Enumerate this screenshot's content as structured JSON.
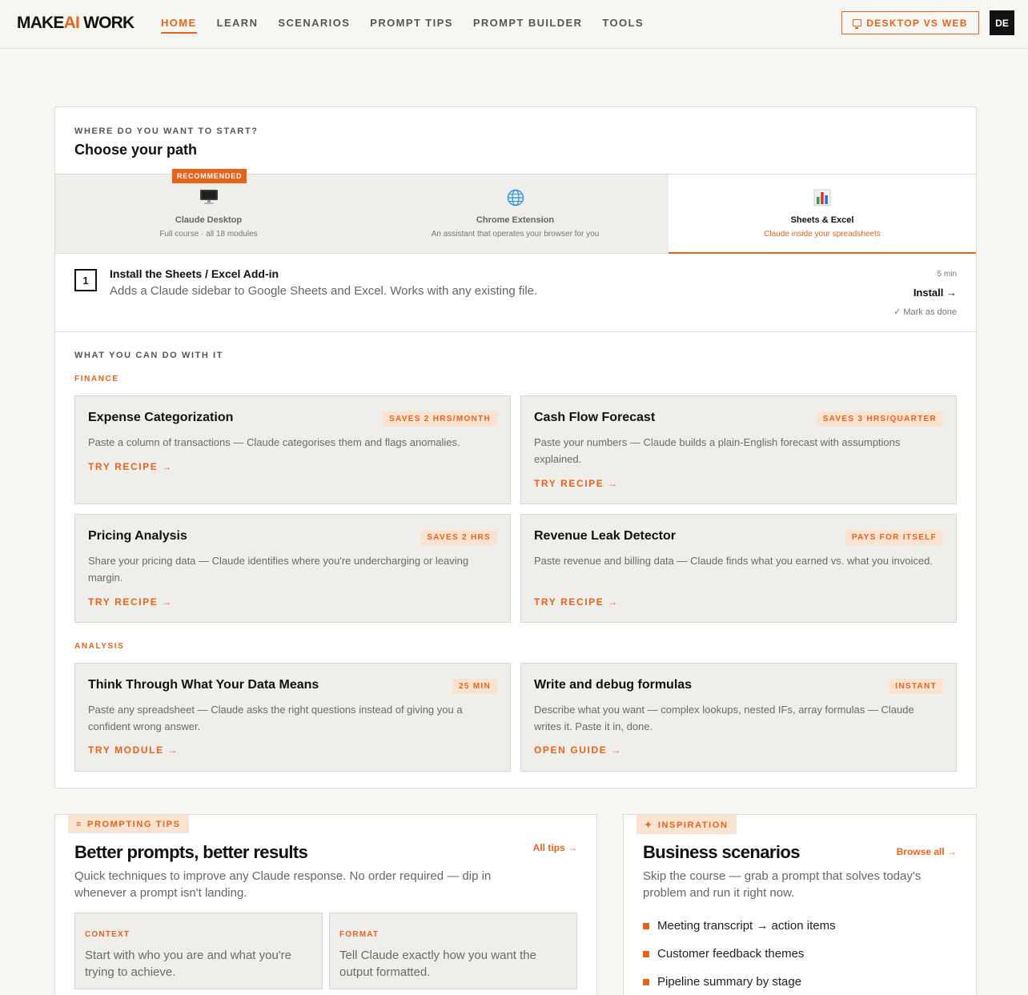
{
  "brand": {
    "make": "MAKE",
    "ai": "AI",
    "work": "WORK"
  },
  "nav": {
    "items": [
      "HOME",
      "LEARN",
      "SCENARIOS",
      "PROMPT TIPS",
      "PROMPT BUILDER",
      "TOOLS"
    ],
    "active": "HOME",
    "desktop_vs_web": "DESKTOP VS WEB",
    "lang": "DE"
  },
  "path_panel": {
    "eyebrow": "WHERE DO YOU WANT TO START?",
    "title": "Choose your path",
    "tabs": [
      {
        "title": "Claude Desktop",
        "subtitle": "Full course · all 18 modules",
        "badge": "RECOMMENDED",
        "icon": "desktop-computer-icon"
      },
      {
        "title": "Chrome Extension",
        "subtitle": "An assistant that operates your browser for you",
        "icon": "globe-icon"
      },
      {
        "title": "Sheets & Excel",
        "subtitle": "Claude inside your spreadsheets",
        "icon": "bar-chart-icon",
        "active": true
      }
    ],
    "step": {
      "number": "1",
      "title": "Install the Sheets / Excel Add-in",
      "desc": "Adds a Claude sidebar to Google Sheets and Excel. Works with any existing file.",
      "time": "5 min",
      "install": "Install →",
      "done": "✓ Mark as done"
    },
    "what_you_can_do": "WHAT YOU CAN DO WITH IT",
    "categories": [
      {
        "label": "FINANCE",
        "cards": [
          {
            "title": "Expense Categorization",
            "badge": "SAVES 2 HRS/MONTH",
            "desc": "Paste a column of transactions — Claude categorises them and flags anomalies.",
            "action": "TRY RECIPE →"
          },
          {
            "title": "Cash Flow Forecast",
            "badge": "SAVES 3 HRS/QUARTER",
            "desc": "Paste your numbers — Claude builds a plain-English forecast with assumptions explained.",
            "action": "TRY RECIPE →"
          },
          {
            "title": "Pricing Analysis",
            "badge": "SAVES 2 HRS",
            "desc": "Share your pricing data — Claude identifies where you're undercharging or leaving margin.",
            "action": "TRY RECIPE →"
          },
          {
            "title": "Revenue Leak Detector",
            "badge": "PAYS FOR ITSELF",
            "desc": "Paste revenue and billing data — Claude finds what you earned vs. what you invoiced.",
            "action": "TRY RECIPE →"
          }
        ]
      },
      {
        "label": "ANALYSIS",
        "cards": [
          {
            "title": "Think Through What Your Data Means",
            "badge": "25 MIN",
            "desc": "Paste any spreadsheet — Claude asks the right questions instead of giving you a confident wrong answer.",
            "action": "TRY MODULE →"
          },
          {
            "title": "Write and debug formulas",
            "badge": "INSTANT",
            "desc": "Describe what you want — complex lookups, nested IFs, array formulas — Claude writes it. Paste it in, done.",
            "action": "OPEN GUIDE →"
          }
        ]
      }
    ]
  },
  "tips_panel": {
    "tag": "PROMPTING TIPS",
    "tag_icon": "≡",
    "title": "Better prompts, better results",
    "link": "All tips →",
    "desc": "Quick techniques to improve any Claude response. No order required — dip in whenever a prompt isn't landing.",
    "tips": [
      {
        "label": "CONTEXT",
        "desc": "Start with who you are and what you're trying to achieve."
      },
      {
        "label": "FORMAT",
        "desc": "Tell Claude exactly how you want the output formatted."
      }
    ]
  },
  "inspiration_panel": {
    "tag": "INSPIRATION",
    "tag_icon": "✦",
    "title": "Business scenarios",
    "link": "Browse all →",
    "desc": "Skip the course — grab a prompt that solves today's problem and run it right now.",
    "scenarios": [
      "Meeting transcript → action items",
      "Customer feedback themes",
      "Pipeline summary by stage"
    ]
  },
  "colors": {
    "accent": "#e8621a",
    "card_bg": "#efeeeb",
    "page_bg": "#f7f6f3",
    "badge_bg": "#fbe3d2"
  }
}
